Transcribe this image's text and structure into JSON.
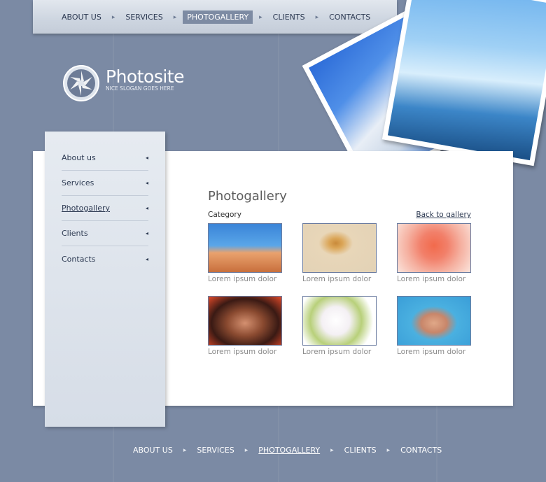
{
  "top_nav": {
    "items": [
      {
        "label": "About us",
        "active": false
      },
      {
        "label": "Services",
        "active": false
      },
      {
        "label": "Photogallery",
        "active": true
      },
      {
        "label": "Clients",
        "active": false
      },
      {
        "label": "Contacts",
        "active": false
      }
    ],
    "separator": "▸"
  },
  "logo": {
    "name": "Photosite",
    "slogan": "Nice slogan goes here"
  },
  "sidebar": {
    "items": [
      {
        "label": "About us",
        "active": false
      },
      {
        "label": "Services",
        "active": false
      },
      {
        "label": "Photogallery",
        "active": true
      },
      {
        "label": "Clients",
        "active": false
      },
      {
        "label": "Contacts",
        "active": false
      }
    ],
    "arrow": "◂"
  },
  "main": {
    "title": "Photogallery",
    "category_label": "Category",
    "back_link": "Back to gallery",
    "thumbnails": [
      {
        "caption": "Lorem ipsum dolor",
        "image": "children-beach-photo"
      },
      {
        "caption": "Lorem ipsum dolor",
        "image": "starfish-sand-photo"
      },
      {
        "caption": "Lorem ipsum dolor",
        "image": "rose-photo"
      },
      {
        "caption": "Lorem ipsum dolor",
        "image": "woman-portrait-photo"
      },
      {
        "caption": "Lorem ipsum dolor",
        "image": "white-flowers-photo"
      },
      {
        "caption": "Lorem ipsum dolor",
        "image": "woman-blue-hat-photo"
      }
    ]
  },
  "bottom_nav": {
    "items": [
      {
        "label": "About us",
        "active": false
      },
      {
        "label": "Services",
        "active": false
      },
      {
        "label": "Photogallery",
        "active": true
      },
      {
        "label": "Clients",
        "active": false
      },
      {
        "label": "Contacts",
        "active": false
      }
    ],
    "separator": "▸"
  },
  "colors": {
    "background": "#7b8aa4",
    "nav_active_bg": "#7d8ba3",
    "text_dark": "#2d3a52",
    "caption_gray": "#8a8a8a",
    "thumb_border": "#6b7ca0"
  }
}
